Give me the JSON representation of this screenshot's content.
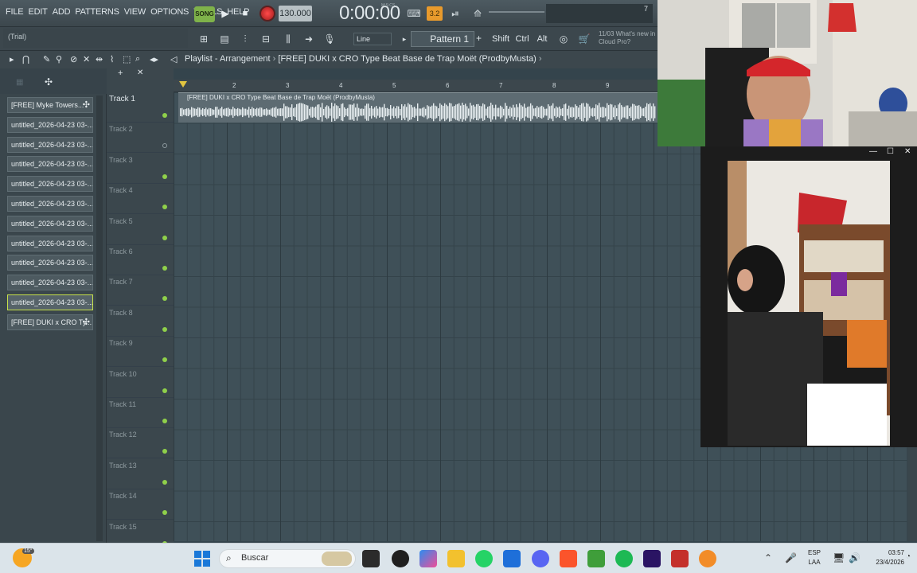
{
  "menu": [
    "FILE",
    "EDIT",
    "ADD",
    "PATTERNS",
    "VIEW",
    "OPTIONS",
    "TOOLS",
    "HELP"
  ],
  "transport": {
    "mode_label": "SONG",
    "tempo": "130.000",
    "time": "0:00:00",
    "time_unit_label": "M:S:CS",
    "cpu_value": "7"
  },
  "toolbar2": {
    "trial_label": "(Trial)",
    "snap_value": "Line",
    "pattern_label": "Pattern 1",
    "shift_label": "Shift",
    "ctrl_label": "Ctrl",
    "alt_label": "Alt",
    "news_date": "11/03",
    "news_text": "What's new in Cloud Pro?"
  },
  "playlist": {
    "title": "Playlist - Arrangement",
    "breadcrumb": "[FREE] DUKI x CRO Type Beat  Base de Trap Moët  (ProdbyMusta)",
    "clip_label": "[FREE] DUKI x CRO Type Beat  Base de Trap Moët  (ProdbyMusta)",
    "ruler_numbers": [
      "2",
      "3",
      "4",
      "5",
      "6",
      "7",
      "8",
      "9"
    ]
  },
  "clips": [
    "[FREE] Myke Towers...",
    "untitled_2026-04-23 03-...",
    "untitled_2026-04-23 03-...",
    "untitled_2026-04-23 03-...",
    "untitled_2026-04-23 03-...",
    "untitled_2026-04-23 03-...",
    "untitled_2026-04-23 03-...",
    "untitled_2026-04-23 03-...",
    "untitled_2026-04-23 03-...",
    "untitled_2026-04-23 03-...",
    "untitled_2026-04-23 03-...",
    "[FREE] DUKI x CRO Ty..."
  ],
  "tracks": [
    "Track 1",
    "Track 2",
    "Track 3",
    "Track 4",
    "Track 5",
    "Track 6",
    "Track 7",
    "Track 8",
    "Track 9",
    "Track 10",
    "Track 11",
    "Track 12",
    "Track 13",
    "Track 14",
    "Track 15"
  ],
  "taskbar": {
    "search_placeholder": "Buscar",
    "weather": "15°",
    "lang_top": "ESP",
    "lang_bottom": "LAA",
    "clock_time": "03:57",
    "clock_date": "23/4/2026"
  },
  "colors": {
    "accent_green": "#8fd04a",
    "record_red": "#e03232",
    "selected_clip_border": "#c6e04a"
  }
}
